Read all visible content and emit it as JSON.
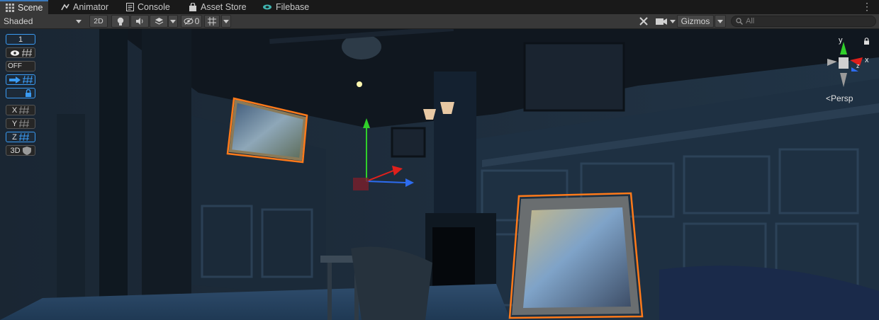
{
  "tabs": [
    {
      "label": "Scene",
      "icon": "scene-grid-icon",
      "active": true
    },
    {
      "label": "Animator",
      "icon": "animator-icon"
    },
    {
      "label": "Console",
      "icon": "console-icon"
    },
    {
      "label": "Asset Store",
      "icon": "asset-store-icon"
    },
    {
      "label": "Filebase",
      "icon": "filebase-icon"
    }
  ],
  "toolbar": {
    "draw_mode": "Shaded",
    "mode_2d": "2D",
    "hidden_count": "0",
    "gizmos": "Gizmos",
    "search_placeholder": "All"
  },
  "overlay": {
    "grid_count": "1",
    "toggle_state": "OFF",
    "axis_x": "X",
    "axis_y": "Y",
    "axis_z": "Z",
    "view_3d": "3D"
  },
  "orientation": {
    "axis_y": "y",
    "axis_x": "x",
    "axis_z": "z",
    "projection": "Persp"
  },
  "colors": {
    "selection_outline": "#ff7a1a",
    "tab_accent": "#3a79bb",
    "gizmo_x": "#e0201c",
    "gizmo_y": "#30d02a",
    "gizmo_z": "#2d6cf0"
  }
}
